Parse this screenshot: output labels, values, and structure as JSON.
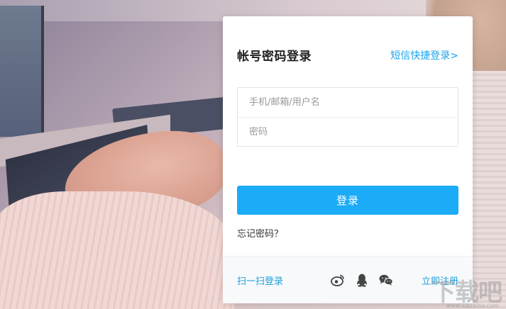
{
  "login": {
    "title": "帐号密码登录",
    "sms_link": "短信快捷登录>",
    "username_placeholder": "手机/邮箱/用户名",
    "password_placeholder": "密码",
    "submit_label": "登录",
    "forgot_label": "忘记密码？"
  },
  "footer": {
    "scan_label": "扫一扫登录",
    "register_label": "立即注册",
    "social_icons": [
      "weibo-icon",
      "qq-icon",
      "wechat-icon"
    ]
  },
  "watermark": {
    "text": "下载吧",
    "sub": "www.xiazaiba.com"
  },
  "colors": {
    "accent": "#1cabf7",
    "link": "#1e9fd9",
    "card_bg": "#ffffff",
    "footer_bg": "#f7f9fb"
  }
}
